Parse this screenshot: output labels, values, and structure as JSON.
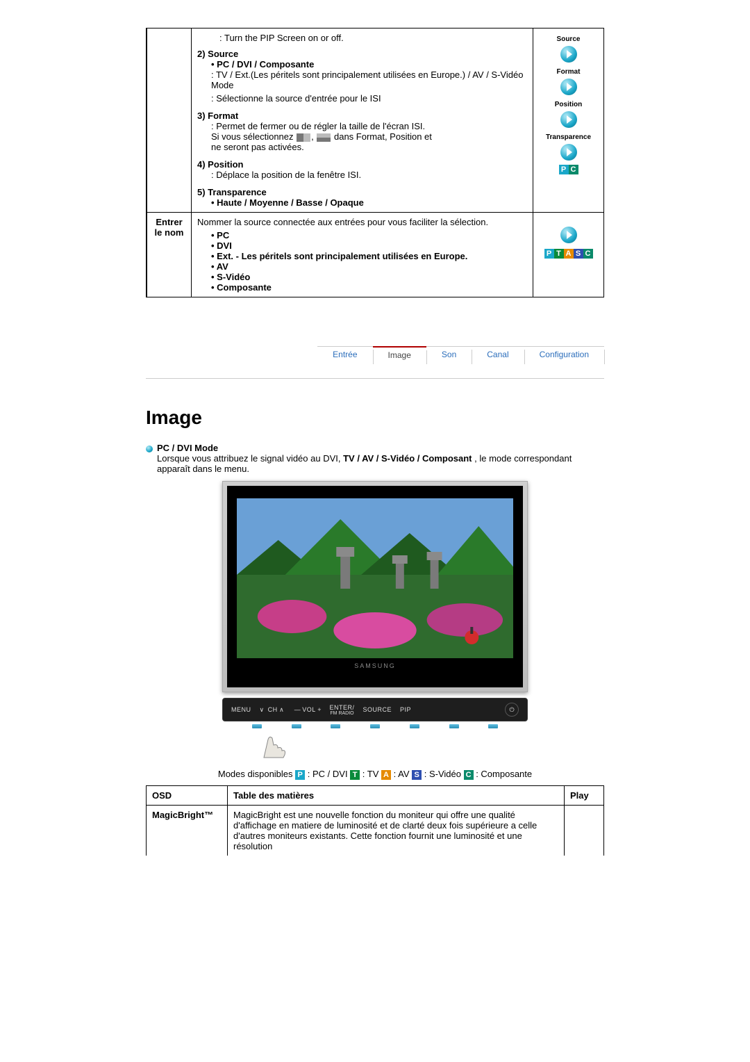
{
  "table1": {
    "pip_intro": ": Turn the PIP Screen on or off.",
    "source_title": "2) Source",
    "source_bullet": "PC / DVI / Composante",
    "source_line1": ": TV / Ext.(Les péritels sont principalement utilisées en Europe.) / AV / S-Vidéo Mode",
    "source_line2": ": Sélectionne la source d'entrée pour le ISI",
    "format_title": "3) Format",
    "format_line1": ": Permet de fermer ou de régler la taille de l'écran ISI.",
    "format_line2a": "Si vous sélectionnez ",
    "format_line2b": " dans Format, Position et",
    "format_line3": "ne seront pas activées.",
    "position_title": "4) Position",
    "position_line": ": Déplace la position de la fenêtre ISI.",
    "transp_title": "5) Transparence",
    "transp_bullet": "Haute / Moyenne / Basse / Opaque",
    "icons": {
      "source": "Source",
      "format": "Format",
      "position": "Position",
      "transparence": "Transparence"
    },
    "row2_label_l1": "Entrer",
    "row2_label_l2": "le nom",
    "row2_intro": "Nommer la source connectée aux entrées pour vous faciliter la sélection.",
    "row2_items": {
      "pc": "PC",
      "dvi": "DVI",
      "ext": "Ext. - Les péritels sont principalement utilisées en Europe.",
      "av": "AV",
      "svideo": "S-Vidéo",
      "composante": "Composante"
    }
  },
  "tabs": {
    "entree": "Entrée",
    "image": "Image",
    "son": "Son",
    "canal": "Canal",
    "config": "Configuration"
  },
  "section": {
    "title": "Image",
    "subhead": "PC / DVI Mode",
    "intro_a": "Lorsque vous attribuez le signal vidéo au DVI, ",
    "intro_bold": "TV / AV / S-Vidéo / Composant ",
    "intro_b": ", le mode correspondant apparaît dans le menu."
  },
  "monitor": {
    "brand": "SAMSUNG",
    "menu": "MENU",
    "ch": "CH",
    "vol": "VOL",
    "enter": "ENTER/",
    "fmradio": "FM RADIO",
    "source": "SOURCE",
    "pip": "PIP"
  },
  "modes_line": {
    "prefix": "Modes disponibles ",
    "pc": " : PC / DVI  ",
    "tv": " : TV  ",
    "av": " : AV  ",
    "sv": " : S-Vidéo  ",
    "co": " : Composante"
  },
  "table2": {
    "h_osd": "OSD",
    "h_toc": "Table des matières",
    "h_play": "Play",
    "r1_osd": "MagicBright™",
    "r1_text": "MagicBright est une nouvelle fonction du moniteur qui offre une qualité d'affichage en matiere de luminosité et de clarté deux fois supérieure a celle d'autres moniteurs existants. Cette fonction fournit une luminosité et une résolution"
  }
}
